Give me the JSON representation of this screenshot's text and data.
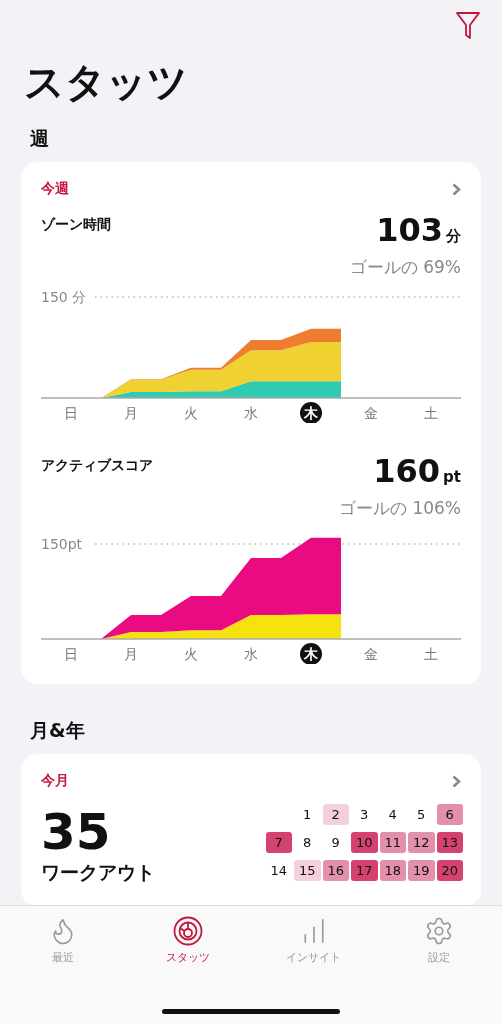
{
  "title": "スタッツ",
  "week": {
    "heading": "週",
    "card_label": "今週",
    "metrics": [
      {
        "kind": "zone",
        "name": "ゾーン時間",
        "value": "103",
        "unit": "分",
        "goal": "ゴールの 69%",
        "axis_label": "150 分",
        "days": [
          {
            "label": "日",
            "today": false
          },
          {
            "label": "月",
            "today": false
          },
          {
            "label": "火",
            "today": false
          },
          {
            "label": "水",
            "today": false
          },
          {
            "label": "木",
            "today": true
          },
          {
            "label": "金",
            "today": false
          },
          {
            "label": "土",
            "today": false
          }
        ]
      },
      {
        "kind": "score",
        "name": "アクティブスコア",
        "value": "160",
        "unit": "pt",
        "goal": "ゴールの 106%",
        "axis_label": "150pt",
        "days": [
          {
            "label": "日",
            "today": false
          },
          {
            "label": "月",
            "today": false
          },
          {
            "label": "火",
            "today": false
          },
          {
            "label": "水",
            "today": false
          },
          {
            "label": "木",
            "today": true
          },
          {
            "label": "金",
            "today": false
          },
          {
            "label": "土",
            "today": false
          }
        ]
      }
    ]
  },
  "month": {
    "heading": "月&年",
    "card_label": "今月",
    "value": "35",
    "caption": "ワークアウト",
    "days": [
      {
        "label": "1",
        "color": "#ffffff"
      },
      {
        "label": "2",
        "color": "#f5d0dc"
      },
      {
        "label": "3",
        "color": "#ffffff"
      },
      {
        "label": "4",
        "color": "#ffffff"
      },
      {
        "label": "5",
        "color": "#ffffff"
      },
      {
        "label": "6",
        "color": "#e290ab"
      },
      {
        "label": "7",
        "color": "#d4436f"
      },
      {
        "label": "8",
        "color": "#ffffff"
      },
      {
        "label": "9",
        "color": "#ffffff"
      },
      {
        "label": "10",
        "color": "#d4436f"
      },
      {
        "label": "11",
        "color": "#e290ab"
      },
      {
        "label": "12",
        "color": "#e290ab"
      },
      {
        "label": "13",
        "color": "#d4436f"
      },
      {
        "label": "14",
        "color": "#ffffff"
      },
      {
        "label": "15",
        "color": "#f5d0dc"
      },
      {
        "label": "16",
        "color": "#e290ab"
      },
      {
        "label": "17",
        "color": "#d4436f"
      },
      {
        "label": "18",
        "color": "#e290ab"
      },
      {
        "label": "19",
        "color": "#e290ab"
      },
      {
        "label": "20",
        "color": "#d4436f"
      }
    ]
  },
  "tabs": [
    {
      "kind": "flame",
      "label": "最近",
      "selected": false
    },
    {
      "kind": "ring",
      "label": "スタッツ",
      "selected": true
    },
    {
      "kind": "bars",
      "label": "インサイト",
      "selected": false
    },
    {
      "kind": "gear",
      "label": "設定",
      "selected": false
    }
  ]
}
